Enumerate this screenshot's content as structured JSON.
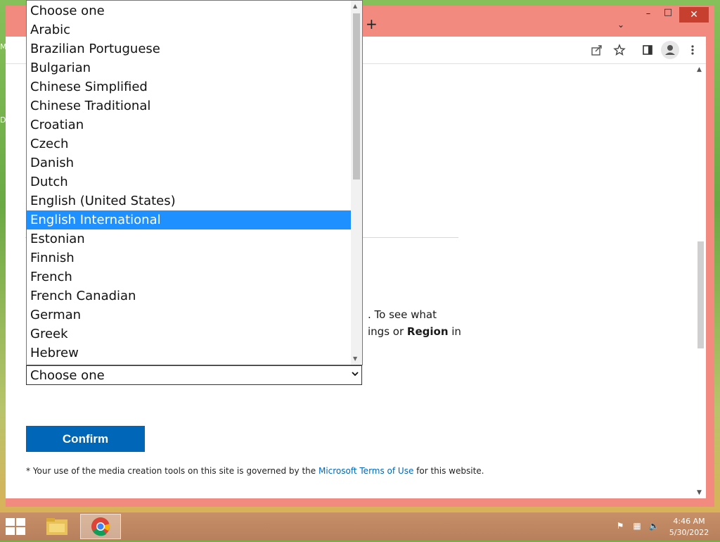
{
  "desktop": {
    "icon_labels": [
      "M",
      "D"
    ]
  },
  "browser": {
    "new_tab_glyph": "+",
    "tab_list_glyph": "⌄",
    "window_controls": {
      "minimize": "–",
      "maximize": "□",
      "close": "✕"
    },
    "toolbar_icons": [
      "share-icon",
      "star-icon",
      "side-panel-icon",
      "profile-icon",
      "menu-icon"
    ]
  },
  "page": {
    "paragraph_line1_tail": ". To see what",
    "paragraph_line2_pre": "ings or ",
    "paragraph_line2_bold": "Region",
    "paragraph_line2_post": " in",
    "select_value": "Choose one",
    "confirm_label": "Confirm",
    "footnote_pre": "* Your use of the media creation tools on this site is governed by the ",
    "footnote_link": "Microsoft Terms of Use",
    "footnote_post": " for this website."
  },
  "dropdown": {
    "options": [
      "Choose one",
      "Arabic",
      "Brazilian Portuguese",
      "Bulgarian",
      "Chinese Simplified",
      "Chinese Traditional",
      "Croatian",
      "Czech",
      "Danish",
      "Dutch",
      "English (United States)",
      "English International",
      "Estonian",
      "Finnish",
      "French",
      "French Canadian",
      "German",
      "Greek",
      "Hebrew"
    ],
    "highlighted": "English International"
  },
  "taskbar": {
    "time": "4:46 AM",
    "date": "5/30/2022"
  },
  "colors": {
    "window_frame": "#f28a80",
    "highlight": "#1e90ff",
    "confirm_bg": "#0067b8",
    "link": "#0067b8"
  }
}
